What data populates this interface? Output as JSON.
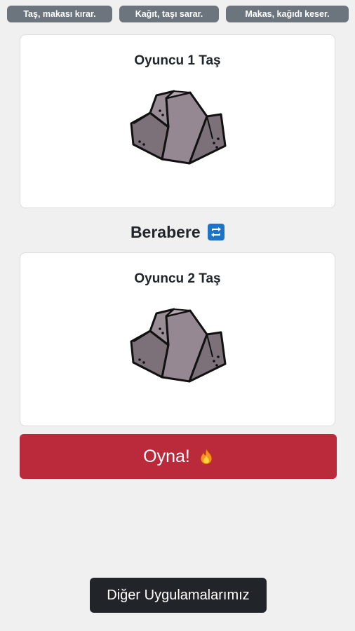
{
  "rules": {
    "rock": "Taş, makası kırar.",
    "paper": "Kağıt, taşı sarar.",
    "scissors": "Makas, kağıdı keser."
  },
  "player1": {
    "title": "Oyuncu 1 Taş",
    "choice_icon": "rock-icon"
  },
  "result": {
    "text": "Berabere",
    "icon": "repeat-icon",
    "icon_color": "#1e73c8"
  },
  "player2": {
    "title": "Oyuncu 2 Taş",
    "choice_icon": "rock-icon"
  },
  "play_button": {
    "label": "Oyna!",
    "icon": "fire-icon",
    "color": "#bb2a3a"
  },
  "other_apps_button": {
    "label": "Diğer Uygulamalarımız",
    "color": "#212529"
  }
}
